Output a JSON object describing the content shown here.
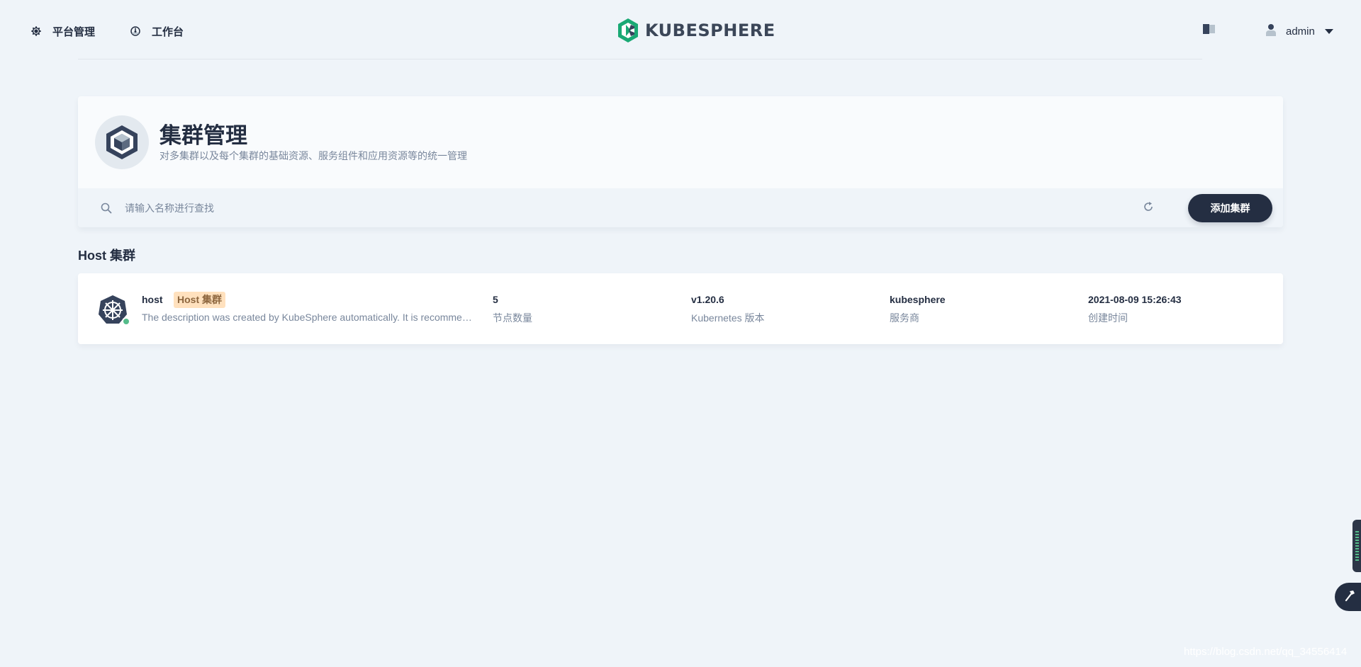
{
  "header": {
    "nav": [
      {
        "label": "平台管理",
        "icon": "gear-icon"
      },
      {
        "label": "工作台",
        "icon": "dashboard-icon"
      }
    ],
    "logo_text": "KUBESPHERE",
    "user_name": "admin",
    "brand_color": "#19a974"
  },
  "banner": {
    "title": "集群管理",
    "description": "对多集群以及每个集群的基础资源、服务组件和应用资源等的统一管理",
    "search_placeholder": "请输入名称进行查找",
    "add_button_label": "添加集群"
  },
  "section_title": "Host 集群",
  "clusters": [
    {
      "name": "host",
      "tag": "Host 集群",
      "description": "The description was created by KubeSphere automatically. It is recommended that you use the Host Cluster to manage clusters only and deploy workloads on Member Clusters.",
      "status": "running",
      "fields": [
        {
          "value": "5",
          "label": "节点数量"
        },
        {
          "value": "v1.20.6",
          "label": "Kubernetes 版本"
        },
        {
          "value": "kubesphere",
          "label": "服务商"
        },
        {
          "value": "2021-08-09 15:26:43",
          "label": "创建时间"
        }
      ]
    }
  ],
  "watermark": "https://blog.csdn.net/qq_34556414"
}
